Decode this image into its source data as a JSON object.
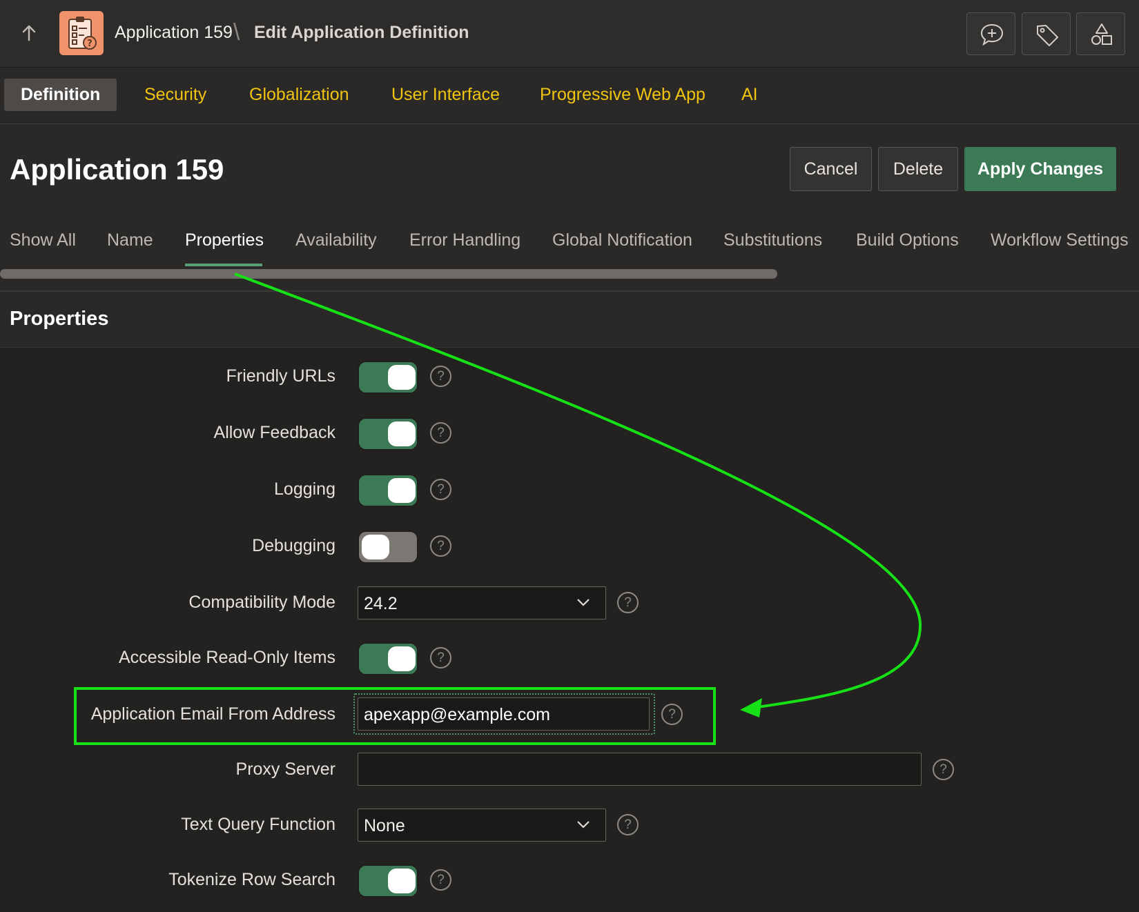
{
  "header": {
    "breadcrumb_app": "Application 159",
    "breadcrumb_sep": "\\",
    "breadcrumb_page": "Edit Application Definition"
  },
  "page_tabs": [
    {
      "label": "Definition"
    },
    {
      "label": "Security"
    },
    {
      "label": "Globalization"
    },
    {
      "label": "User Interface"
    },
    {
      "label": "Progressive Web App"
    },
    {
      "label": "AI"
    }
  ],
  "title": "Application 159",
  "actions": {
    "cancel": "Cancel",
    "delete": "Delete",
    "apply": "Apply Changes"
  },
  "region_tabs": [
    {
      "label": "Show All"
    },
    {
      "label": "Name"
    },
    {
      "label": "Properties"
    },
    {
      "label": "Availability"
    },
    {
      "label": "Error Handling"
    },
    {
      "label": "Global Notification"
    },
    {
      "label": "Substitutions"
    },
    {
      "label": "Build Options"
    },
    {
      "label": "Workflow Settings"
    }
  ],
  "region": {
    "title": "Properties",
    "fields": {
      "friendly_urls": {
        "label": "Friendly URLs",
        "on": true
      },
      "allow_feedback": {
        "label": "Allow Feedback",
        "on": true
      },
      "logging": {
        "label": "Logging",
        "on": true
      },
      "debugging": {
        "label": "Debugging",
        "on": false
      },
      "compatibility_mode": {
        "label": "Compatibility Mode",
        "value": "24.2"
      },
      "accessible_readonly": {
        "label": "Accessible Read-Only Items",
        "on": true
      },
      "email_from": {
        "label": "Application Email From Address",
        "value": "apexapp@example.com"
      },
      "proxy_server": {
        "label": "Proxy Server",
        "value": ""
      },
      "text_query_function": {
        "label": "Text Query Function",
        "value": "None"
      },
      "tokenize_row_search": {
        "label": "Tokenize Row Search",
        "on": true
      }
    }
  },
  "help_glyph": "?",
  "colors": {
    "accent_green": "#3c7a56",
    "tab_yellow": "#f1c40f",
    "annotation_green": "#16e016"
  }
}
